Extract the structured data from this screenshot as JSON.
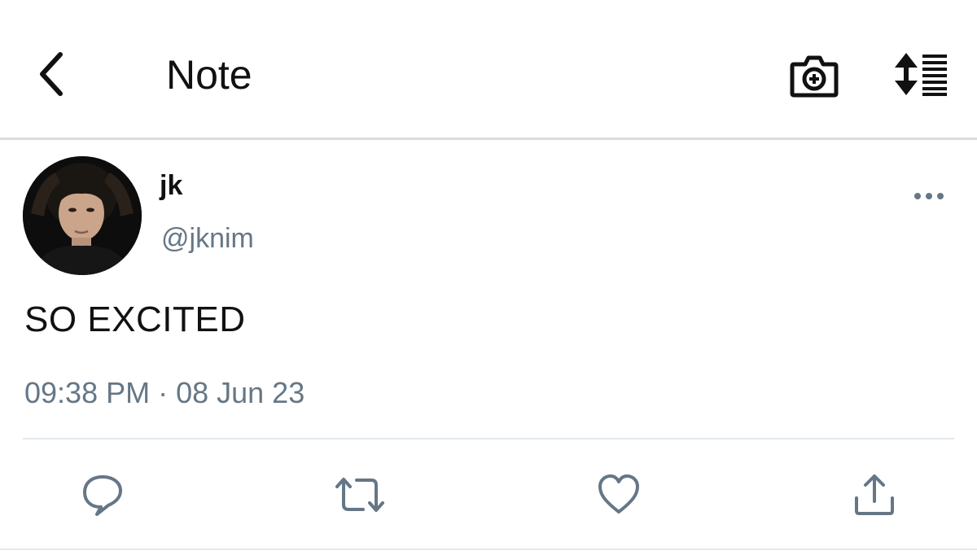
{
  "header": {
    "title": "Note",
    "back_icon": "chevron-left-icon",
    "camera_icon": "camera-plus-icon",
    "sort_icon": "sort-list-icon"
  },
  "post": {
    "display_name": "jk",
    "username": "@jknim",
    "text": "SO EXCITED",
    "timestamp": "09:38 PM · 08 Jun 23",
    "more_icon": "more-horizontal-icon"
  },
  "actions": [
    {
      "icon": "reply-icon"
    },
    {
      "icon": "retweet-icon"
    },
    {
      "icon": "heart-icon"
    },
    {
      "icon": "share-icon"
    }
  ],
  "colors": {
    "text_primary": "#111111",
    "text_secondary": "#657786",
    "divider": "#dcdcdc",
    "icon": "#657786"
  }
}
